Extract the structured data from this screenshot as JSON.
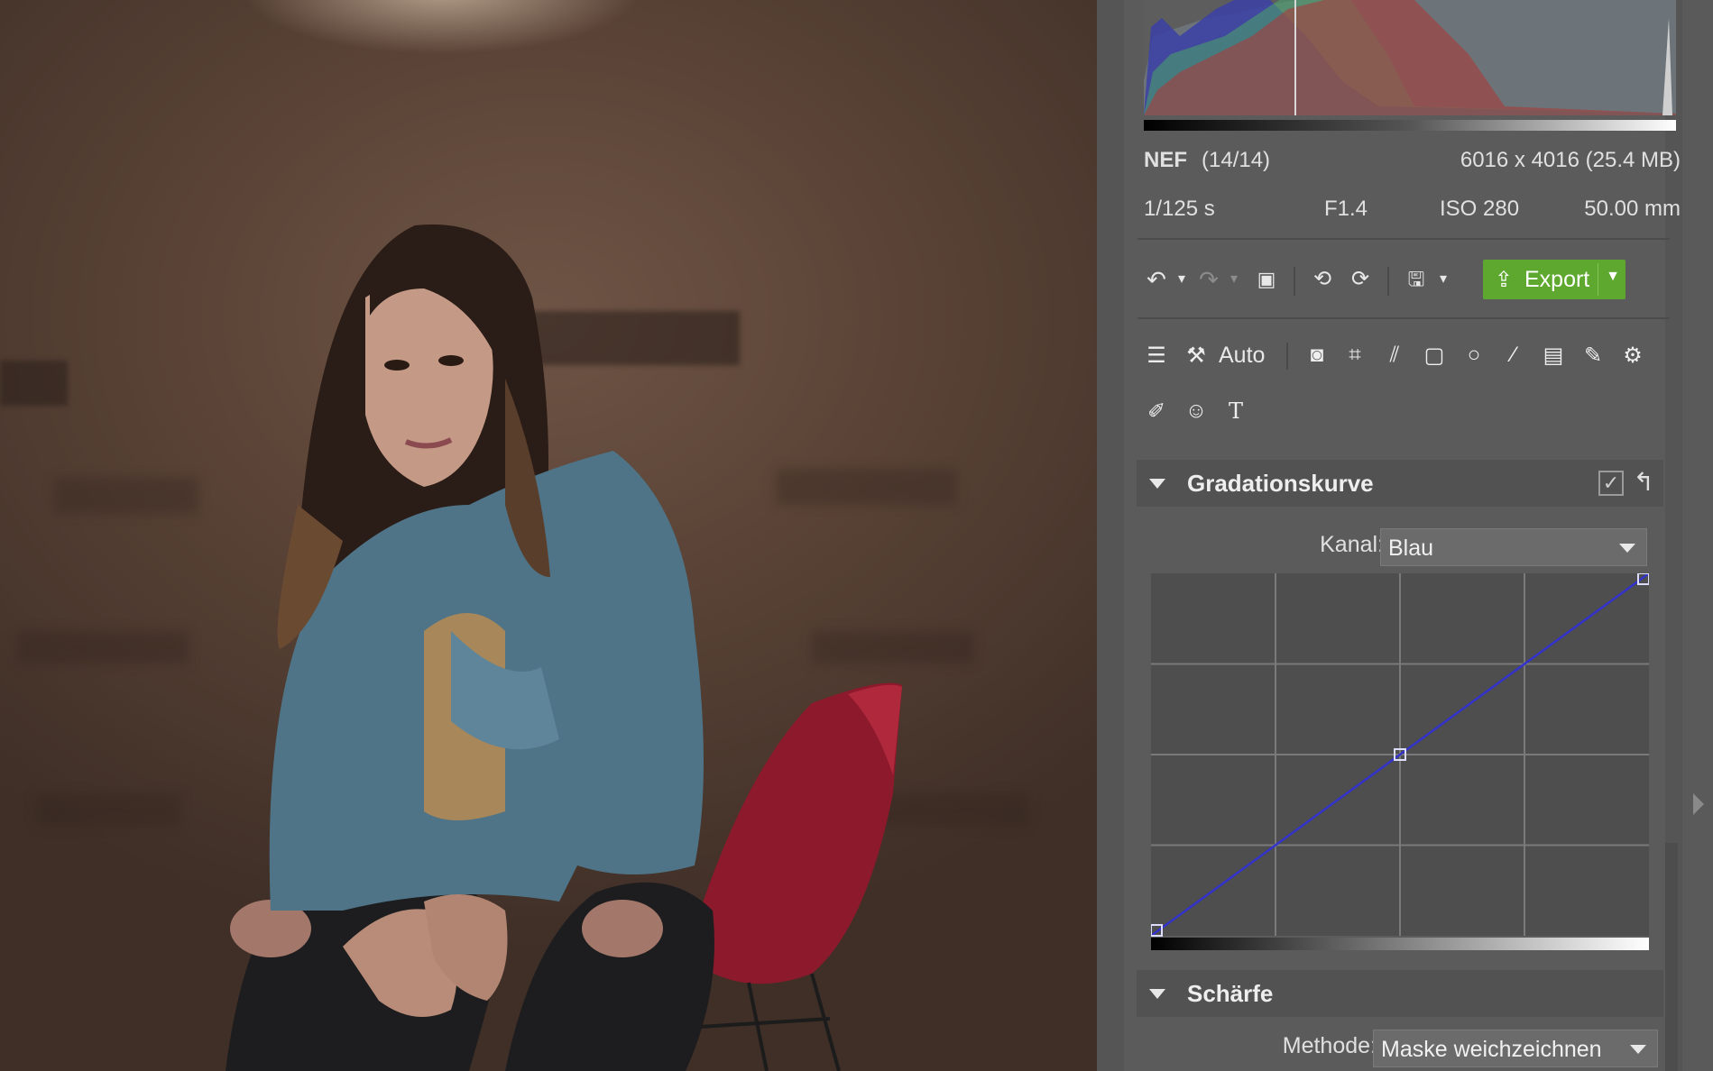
{
  "file": {
    "format": "NEF",
    "index": "(14/14)",
    "dimensions": "6016 x 4016 (25.4 MB)"
  },
  "exif": {
    "shutter": "1/125 s",
    "aperture": "F1.4",
    "iso": "ISO 280",
    "focal_length": "50.00 mm"
  },
  "toolbar": {
    "export_label": "Export",
    "auto_label": "Auto"
  },
  "curves": {
    "title": "Gradationskurve",
    "channel_label": "Kanal:",
    "channel_value": "Blau",
    "points": [
      [
        0,
        0
      ],
      [
        0.5,
        0.5
      ],
      [
        1,
        1
      ]
    ],
    "curve_color": "#3333cc"
  },
  "sharpen": {
    "title": "Schärfe",
    "method_label": "Methode:",
    "method_value": "Maske weichzeichnen"
  },
  "colors": {
    "export_green": "#5fa82f",
    "panel_bg": "#5b5b5b"
  }
}
